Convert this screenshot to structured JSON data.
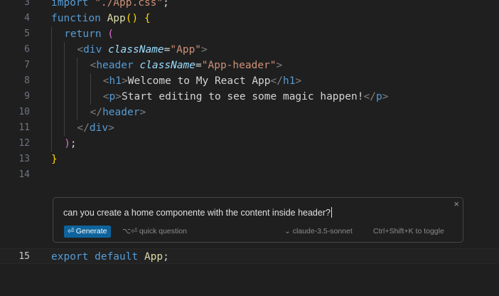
{
  "editor": {
    "lines": [
      {
        "num": "3",
        "tokens": [
          {
            "t": "import ",
            "c": "kw"
          },
          {
            "t": "\"./App.css\"",
            "c": "str"
          },
          {
            "t": ";",
            "c": "pun"
          }
        ]
      },
      {
        "num": "4",
        "tokens": [
          {
            "t": "function ",
            "c": "kw"
          },
          {
            "t": "App",
            "c": "fn"
          },
          {
            "t": "()",
            "c": "br1"
          },
          {
            "t": " ",
            "c": "pun"
          },
          {
            "t": "{",
            "c": "br1"
          }
        ]
      },
      {
        "num": "5",
        "tokens": [
          {
            "t": "return ",
            "c": "kw"
          },
          {
            "t": "(",
            "c": "br2"
          }
        ]
      },
      {
        "num": "6",
        "tokens": [
          {
            "t": "<",
            "c": "tagb"
          },
          {
            "t": "div",
            "c": "tag"
          },
          {
            "t": " ",
            "c": "pun"
          },
          {
            "t": "className",
            "c": "attr"
          },
          {
            "t": "=",
            "c": "pun"
          },
          {
            "t": "\"App\"",
            "c": "str"
          },
          {
            "t": ">",
            "c": "tagb"
          }
        ]
      },
      {
        "num": "7",
        "tokens": [
          {
            "t": "<",
            "c": "tagb"
          },
          {
            "t": "header",
            "c": "tag"
          },
          {
            "t": " ",
            "c": "pun"
          },
          {
            "t": "className",
            "c": "attr"
          },
          {
            "t": "=",
            "c": "pun"
          },
          {
            "t": "\"App-header\"",
            "c": "str"
          },
          {
            "t": ">",
            "c": "tagb"
          }
        ]
      },
      {
        "num": "8",
        "tokens": [
          {
            "t": "<",
            "c": "tagb"
          },
          {
            "t": "h1",
            "c": "tag"
          },
          {
            "t": ">",
            "c": "tagb"
          },
          {
            "t": "Welcome to My React App",
            "c": "txt"
          },
          {
            "t": "</",
            "c": "tagb"
          },
          {
            "t": "h1",
            "c": "tag"
          },
          {
            "t": ">",
            "c": "tagb"
          }
        ]
      },
      {
        "num": "9",
        "tokens": [
          {
            "t": "<",
            "c": "tagb"
          },
          {
            "t": "p",
            "c": "tag"
          },
          {
            "t": ">",
            "c": "tagb"
          },
          {
            "t": "Start editing to see some magic happen!",
            "c": "txt"
          },
          {
            "t": "</",
            "c": "tagb"
          },
          {
            "t": "p",
            "c": "tag"
          },
          {
            "t": ">",
            "c": "tagb"
          }
        ]
      },
      {
        "num": "10",
        "tokens": [
          {
            "t": "</",
            "c": "tagb"
          },
          {
            "t": "header",
            "c": "tag"
          },
          {
            "t": ">",
            "c": "tagb"
          }
        ]
      },
      {
        "num": "11",
        "tokens": [
          {
            "t": "</",
            "c": "tagb"
          },
          {
            "t": "div",
            "c": "tag"
          },
          {
            "t": ">",
            "c": "tagb"
          }
        ]
      },
      {
        "num": "12",
        "tokens": [
          {
            "t": ")",
            "c": "br2"
          },
          {
            "t": ";",
            "c": "pun"
          }
        ]
      },
      {
        "num": "13",
        "tokens": [
          {
            "t": "}",
            "c": "br1"
          }
        ]
      },
      {
        "num": "14",
        "tokens": []
      }
    ],
    "after_lines": [
      {
        "num": "15",
        "tokens": [
          {
            "t": "export ",
            "c": "kw"
          },
          {
            "t": "default ",
            "c": "kw"
          },
          {
            "t": "App",
            "c": "fn"
          },
          {
            "t": ";",
            "c": "pun"
          }
        ]
      }
    ]
  },
  "prompt": {
    "text": "can you create a home componente with the content inside header?",
    "generate_label": "Generate",
    "generate_icon": "return-key-icon",
    "quick_question_label": "quick question",
    "quick_question_shortcut": "⌥⏎",
    "model_name": "claude-3.5-sonnet",
    "toggle_hint": "Ctrl+Shift+K to toggle",
    "close_glyph": "×"
  },
  "colors": {
    "background": "#1f1f1f",
    "keyword": "#569cd6",
    "function": "#dcdcaa",
    "string": "#ce9178",
    "attribute": "#9cdcfe",
    "generate_button": "#0e639c"
  }
}
